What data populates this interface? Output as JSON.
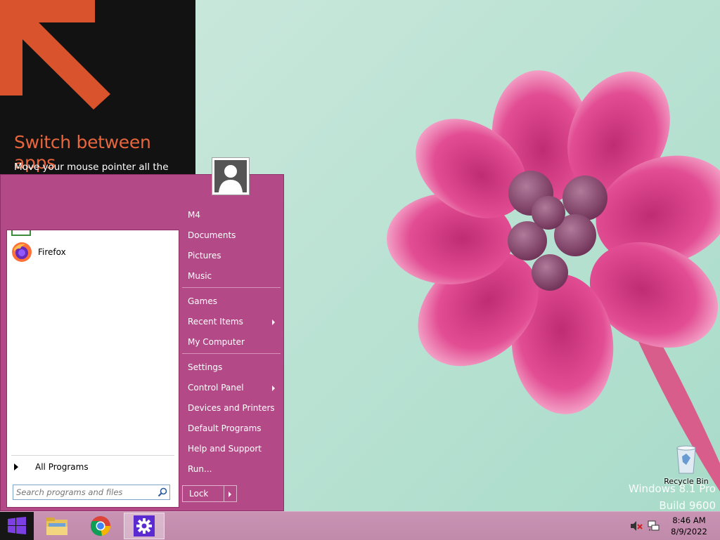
{
  "tooltip": {
    "title": "Switch between apps",
    "body": "Move your mouse pointer all the way into the corner, and then click to go back to the last app you were using."
  },
  "start_menu": {
    "programs": [
      {
        "label": "Firefox",
        "icon": "firefox-icon"
      }
    ],
    "all_programs_label": "All Programs",
    "search": {
      "placeholder": "Search programs and files",
      "value": ""
    },
    "user_name_partial": "M4",
    "right_items": [
      {
        "label": "Documents",
        "submenu": false
      },
      {
        "label": "Pictures",
        "submenu": false
      },
      {
        "label": "Music",
        "submenu": false
      },
      {
        "label": "Games",
        "submenu": false
      },
      {
        "label": "Recent Items",
        "submenu": true
      },
      {
        "label": "My Computer",
        "submenu": false
      },
      {
        "label": "Settings",
        "submenu": false
      },
      {
        "label": "Control Panel",
        "submenu": true
      },
      {
        "label": "Devices and Printers",
        "submenu": false
      },
      {
        "label": "Default Programs",
        "submenu": false
      },
      {
        "label": "Help and Support",
        "submenu": false
      },
      {
        "label": "Run...",
        "submenu": false
      }
    ],
    "lock_label": "Lock",
    "accent_color": "#b34a87"
  },
  "desktop": {
    "recycle_bin_label": "Recycle Bin",
    "watermark_line1": "Windows 8.1 Pro",
    "watermark_line2": "Build 9600"
  },
  "taskbar": {
    "items": [
      {
        "name": "start-button",
        "icon": "windows-logo-icon"
      },
      {
        "name": "file-explorer",
        "icon": "folder-icon"
      },
      {
        "name": "chrome",
        "icon": "chrome-icon"
      },
      {
        "name": "settings",
        "icon": "gear-icon",
        "active": true
      }
    ],
    "clock": {
      "time": "8:46 AM",
      "date": "8/9/2022"
    },
    "tray_icons": [
      "volume-muted-icon",
      "network-icon"
    ]
  }
}
